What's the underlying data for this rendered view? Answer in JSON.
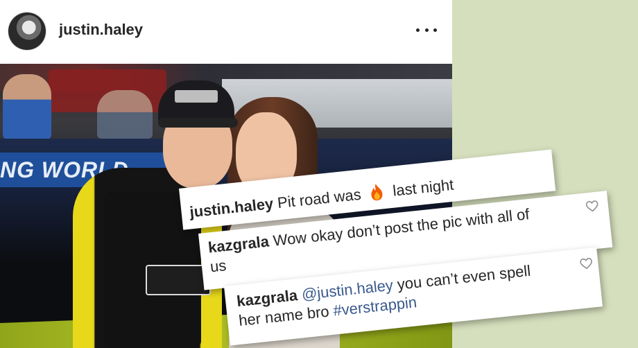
{
  "post": {
    "username": "justin.haley",
    "more_icon": "ellipsis-horizontal-icon"
  },
  "photo": {
    "banner_text": "NG WORLD"
  },
  "comments": [
    {
      "username": "justin.haley",
      "text_before": "Pit road was",
      "emoji": "fire",
      "text_after": "last night"
    },
    {
      "username": "kazgrala",
      "line1": "Wow okay don’t post the pic with all of",
      "line2": "us",
      "icon": "heart-outline-icon"
    },
    {
      "username": "kazgrala",
      "mention": "@justin.haley",
      "text_after_mention": "you can’t even spell",
      "line2_text": "her name bro",
      "hashtag": "#verstrappin",
      "icon": "heart-outline-icon"
    }
  ],
  "colors": {
    "background": "#d6dfbd",
    "link": "#3a5a8d",
    "text": "#262626"
  }
}
